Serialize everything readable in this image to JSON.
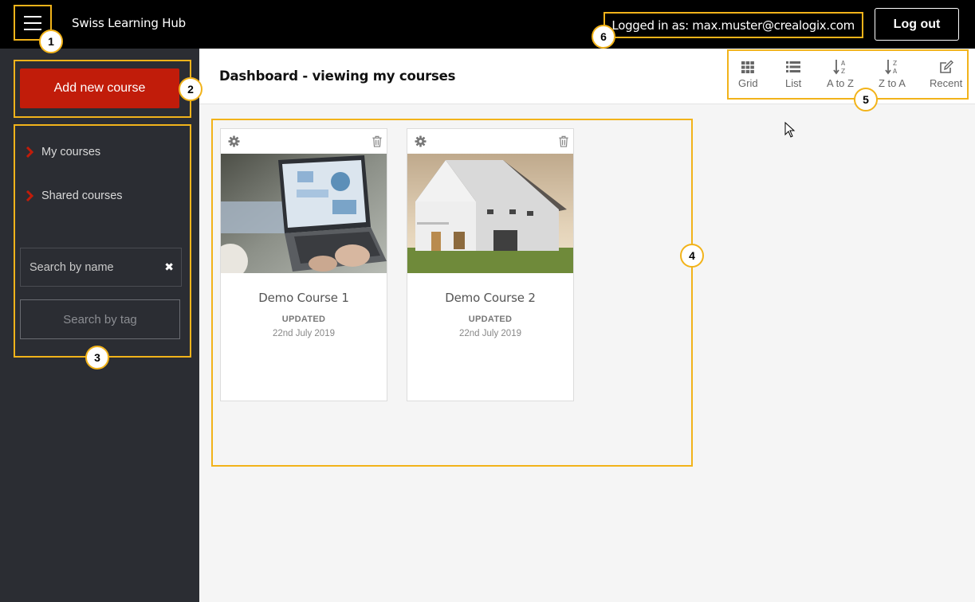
{
  "header": {
    "brand": "Swiss Learning Hub",
    "logged_in": "Logged in as: max.muster@crealogix.com",
    "logout_label": "Log out"
  },
  "sidebar": {
    "add_course_label": "Add new course",
    "nav": [
      {
        "label": "My courses",
        "icon": "chevron-right-icon"
      },
      {
        "label": "Shared courses",
        "icon": "chevron-right-icon"
      }
    ],
    "search_name_placeholder": "Search by name",
    "search_clear_icon": "✖",
    "search_tag_placeholder": "Search by tag"
  },
  "main": {
    "title": "Dashboard - viewing my courses",
    "views": [
      {
        "label": "Grid",
        "icon": "grid-icon"
      },
      {
        "label": "List",
        "icon": "list-icon"
      },
      {
        "label": "A to Z",
        "icon": "sort-az-icon"
      },
      {
        "label": "Z to A",
        "icon": "sort-za-icon"
      },
      {
        "label": "Recent",
        "icon": "edit-icon"
      }
    ],
    "courses": [
      {
        "title": "Demo Course 1",
        "status": "UPDATED",
        "date": "22nd July 2019",
        "image": "laptop-photo"
      },
      {
        "title": "Demo Course 2",
        "status": "UPDATED",
        "date": "22nd July 2019",
        "image": "house-photo"
      }
    ]
  },
  "callouts": [
    "1",
    "2",
    "3",
    "4",
    "5",
    "6"
  ],
  "colors": {
    "accent": "#f2b31a",
    "primary_button": "#c11c0a",
    "sidebar_bg": "#2b2d33",
    "topbar_bg": "#000000"
  }
}
